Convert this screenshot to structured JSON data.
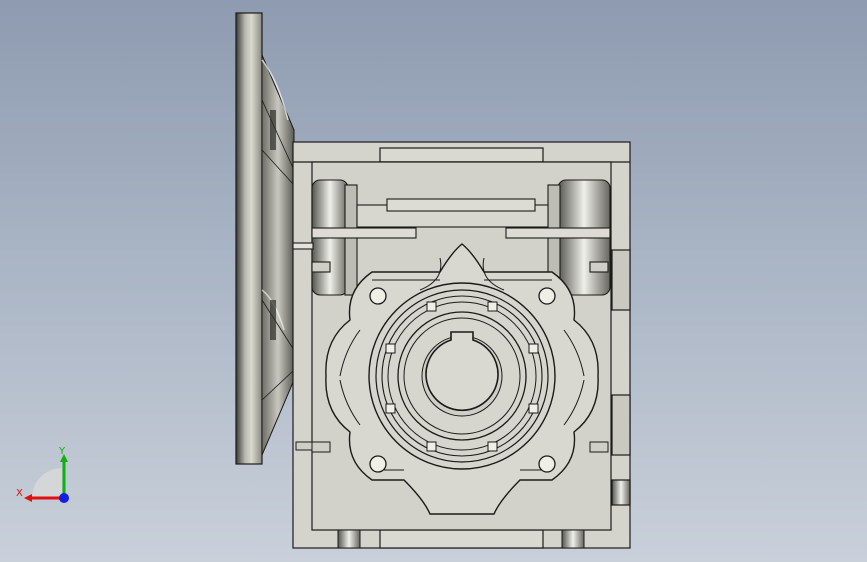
{
  "viewport": {
    "background_top": "#8e9bb0",
    "background_bottom": "#c9d0da",
    "model_fill": "#d4d4cc",
    "model_edge": "#1a1a1a",
    "model_shadow": "#4a4a46"
  },
  "triad": {
    "x_label": "X",
    "y_label": "Y",
    "x_color": "#e01010",
    "y_color": "#10b010",
    "z_color": "#1020e0"
  }
}
